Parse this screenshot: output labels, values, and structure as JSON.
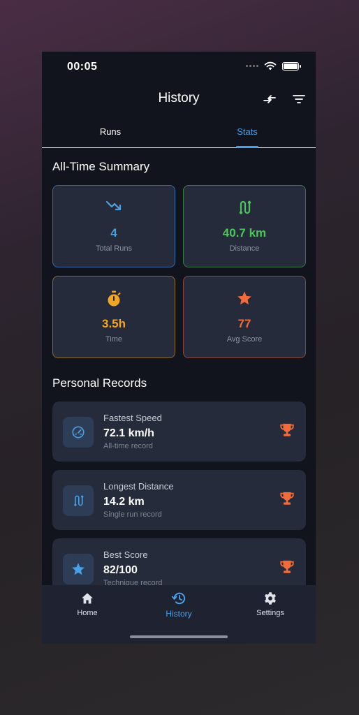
{
  "status_bar": {
    "time": "00:05"
  },
  "header": {
    "title": "History"
  },
  "tabs": [
    {
      "label": "Runs",
      "active": false
    },
    {
      "label": "Stats",
      "active": true
    }
  ],
  "summary": {
    "title": "All-Time Summary",
    "cards": [
      {
        "value": "4",
        "label": "Total Runs",
        "icon": "trending-down-icon",
        "color": "#4aa0e6"
      },
      {
        "value": "40.7 km",
        "label": "Distance",
        "icon": "route-icon",
        "color": "#4cc65a"
      },
      {
        "value": "3.5h",
        "label": "Time",
        "icon": "stopwatch-icon",
        "color": "#f4a623"
      },
      {
        "value": "77",
        "label": "Avg Score",
        "icon": "star-icon",
        "color": "#f26b3a"
      }
    ]
  },
  "records": {
    "title": "Personal Records",
    "items": [
      {
        "title": "Fastest Speed",
        "value": "72.1 km/h",
        "subtitle": "All-time record",
        "icon": "speedometer-icon"
      },
      {
        "title": "Longest Distance",
        "value": "14.2 km",
        "subtitle": "Single run record",
        "icon": "route-icon"
      },
      {
        "title": "Best Score",
        "value": "82/100",
        "subtitle": "Technique record",
        "icon": "star-icon"
      }
    ],
    "trophy_color": "#f26b3a"
  },
  "bottom_nav": [
    {
      "label": "Home",
      "icon": "home-icon",
      "active": false
    },
    {
      "label": "History",
      "icon": "history-icon",
      "active": true
    },
    {
      "label": "Settings",
      "icon": "gear-icon",
      "active": false
    }
  ],
  "colors": {
    "accent": "#4aa0e6",
    "background": "#11141c",
    "card": "#262b3b"
  }
}
